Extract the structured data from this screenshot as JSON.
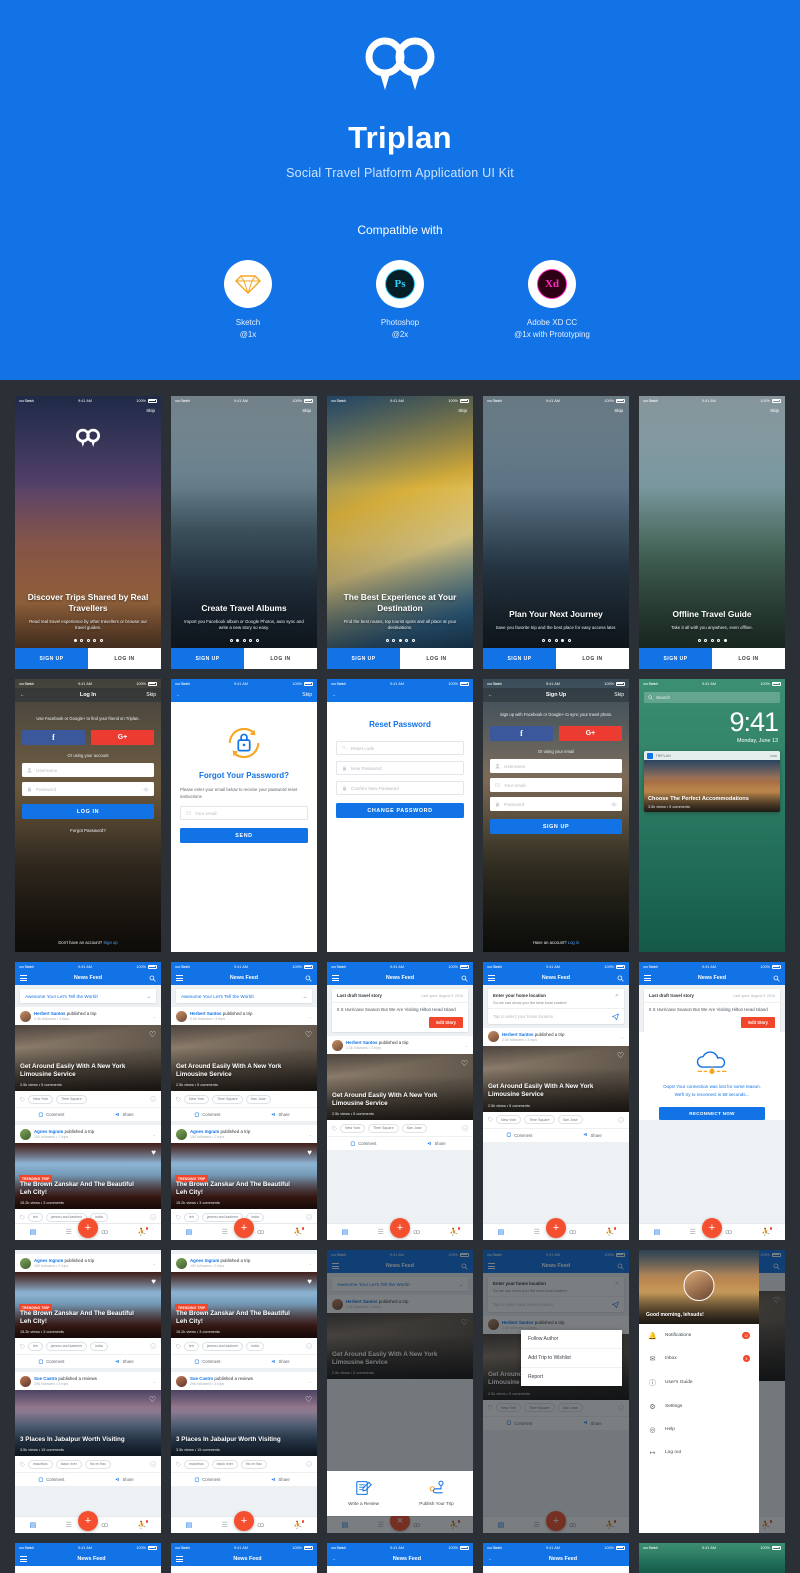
{
  "hero": {
    "logo_icon": "triplan-double-pin-logo",
    "title": "Triplan",
    "subtitle": "Social Travel Platform Application UI Kit",
    "compatible_label": "Compatible with",
    "compat": [
      {
        "icon": "sketch-icon",
        "name": "Sketch",
        "scale": "@1x"
      },
      {
        "icon": "photoshop-icon",
        "name": "Photoshop",
        "scale": "@2x"
      },
      {
        "icon": "adobe-xd-icon",
        "name": "Adobe XD CC",
        "scale": "@1x with Prototyping"
      }
    ]
  },
  "statusbar": {
    "carrier": "••••• Sketch",
    "wifi": "▼",
    "time": "9:41 AM",
    "battery": "100%"
  },
  "onboarding": {
    "skip": "Skip",
    "signup": "SIGN UP",
    "login": "LOG IN",
    "slides": [
      {
        "title": "Discover Trips Shared by Real Travellers",
        "desc": "Read real travel experience by other travellers or browse our travel guides.",
        "active_dot": 0,
        "dots": 5,
        "photo": "eiffel-tower",
        "show_logo": true
      },
      {
        "title": "Create Travel Albums",
        "desc": "Import you Facebook album or Google Photos, auto sync and write a new story so easy.",
        "active_dot": 1,
        "dots": 5,
        "photo": "woman-photographer-lake",
        "show_logo": false
      },
      {
        "title": "The Best Experience at Your Destination",
        "desc": "Find the best routes, top tourist spots and all place at your destinations.",
        "active_dot": 2,
        "dots": 5,
        "photo": "sailboat",
        "show_logo": false
      },
      {
        "title": "Plan Your Next Journey",
        "desc": "Save you favorite trip and the best place for easy access later.",
        "active_dot": 3,
        "dots": 5,
        "photo": "hiker-on-cliff",
        "show_logo": false
      },
      {
        "title": "Offline Travel Guide",
        "desc": "Take it all with you anywhere, even offline.",
        "active_dot": 4,
        "dots": 5,
        "photo": "limestone-cliffs",
        "show_logo": false
      }
    ]
  },
  "login": {
    "nav_title": "Log In",
    "skip": "Skip",
    "back_icon": "arrow-left-icon",
    "hint": "Use Facebook or Google+ to find your friend on Triplan.",
    "facebook_label": "f",
    "google_label": "G+",
    "or_text": "Or using your account",
    "username_placeholder": "Username",
    "password_placeholder": "Password",
    "submit": "LOG IN",
    "forgot": "Forgot Password?",
    "footer_text": "Don't have an account?",
    "footer_link": "Sign up"
  },
  "forgot": {
    "skip": "Skip",
    "title": "Forgot Your Password?",
    "desc": "Please enter your email below to receive your password reset instructions",
    "email_placeholder": "Your email",
    "submit": "SEND",
    "icon": "lock-refresh-icon"
  },
  "reset": {
    "title": "Reset Password",
    "code_placeholder": "Reset code",
    "new_placeholder": "New Password",
    "confirm_placeholder": "Confirm New Password",
    "submit": "CHANGE PASSWORD"
  },
  "signup": {
    "nav_title": "Sign Up",
    "skip": "Skip",
    "hint": "Sign up with Facebook or Google+ to sync your travel photo.",
    "facebook_label": "f",
    "google_label": "G+",
    "or_text": "Or using your email",
    "username_placeholder": "Username",
    "email_placeholder": "Your email",
    "password_placeholder": "Password",
    "submit": "SIGN UP",
    "footer_text": "Have an account?",
    "footer_link": "Log in"
  },
  "lockscreen": {
    "search_placeholder": "Search",
    "time": "9:41",
    "date": "Monday, June 13",
    "notification": {
      "app": "TRIPLAN",
      "time": "now",
      "title": "Choose The Perfect Accommodations",
      "meta": "3.5k views  •  5 comments"
    }
  },
  "feed": {
    "nav_title": "News Feed",
    "menu_icon": "hamburger-icon",
    "search_icon": "search-icon",
    "promo": "Awesome You! Let's Tell the World!",
    "draft": {
      "label": "Last draft travel story",
      "date": "Last open: August 9, 2016",
      "text": "It S Hurricane Season But We Are Visiting Hilton Head Island",
      "edit_button": "Edit Story"
    },
    "location_prompt": {
      "title": "Enter your home location",
      "subtitle": "So we can show you the best local content",
      "placeholder": "Tap to select your home location",
      "close_icon": "close-icon",
      "send_icon": "send-icon"
    },
    "actions": {
      "comment": "Comment",
      "share": "Share"
    },
    "posts": [
      {
        "author": "Herbert Santos",
        "action": "published a trip",
        "stats": "2.5k followers  •  3 trips",
        "title": "Get Around Easily With A New York Limousine Service",
        "meta": "2.5k views  •  5 comments",
        "tags": [
          "New York",
          "Time Square"
        ],
        "tags_extra": [
          "New York",
          "Time Square",
          "San Jose"
        ],
        "badge": "",
        "photo": "new-york-street",
        "avatar": "av-a"
      },
      {
        "author": "Agnes Ingram",
        "action": "published a trip",
        "stats": "150 followers  •  2 trips",
        "title": "The Brown Zanskar And The Beautiful Leh City!",
        "meta": "15.2k views  •  3 comments",
        "tags": [
          "leh",
          "jammu and kashmir",
          "india"
        ],
        "badge": "TRENDING TRIP",
        "photo": "leh-archway",
        "avatar": "av-b"
      },
      {
        "author": "Sue Castro",
        "action": "published a reviews",
        "stats": "296 followers  •  3 trips",
        "title": "3 Places In Jabalpur Worth Visiting",
        "meta": "3.5k views  •  15 comments",
        "tags": [
          "mauritius",
          "black river",
          "flic en flac"
        ],
        "badge": "",
        "photo": "jabalpur-mountains",
        "avatar": "av-c"
      }
    ],
    "tabbar": [
      {
        "icon": "feed-icon",
        "active": true,
        "dot": false
      },
      {
        "icon": "list-icon",
        "active": false,
        "dot": false
      },
      {
        "icon": "add-fab-icon",
        "active": false,
        "dot": false
      },
      {
        "icon": "binoculars-icon",
        "active": false,
        "dot": false
      },
      {
        "icon": "profile-icon",
        "active": false,
        "dot": true
      }
    ],
    "fab_add": "+",
    "fab_close": "×"
  },
  "offline": {
    "icon": "cloud-disconnected-icon",
    "line1": "Oops! Your connection was lost for some reason.",
    "line2": "We'll try to reconnect in 59 seconds...",
    "button": "RECONNECT NOW"
  },
  "action_sheet": [
    {
      "icon": "write-review-icon",
      "label": "Write a Review"
    },
    {
      "icon": "publish-trip-icon",
      "label": "Publish Your Trip"
    }
  ],
  "context_menu": [
    "Follow Author",
    "Add Trip to Wishlist",
    "Report"
  ],
  "drawer": {
    "greeting": "Good morning, lehsuds!",
    "avatar": "user-avatar",
    "items": [
      {
        "icon": "bell-icon",
        "label": "Notifications",
        "badge": "12"
      },
      {
        "icon": "envelope-icon",
        "label": "Inbox",
        "badge": "5"
      },
      {
        "icon": "info-icon",
        "label": "User's Guide",
        "badge": ""
      },
      {
        "icon": "gear-icon",
        "label": "Settings",
        "badge": ""
      },
      {
        "icon": "lifebuoy-icon",
        "label": "Help",
        "badge": ""
      },
      {
        "icon": "logout-icon",
        "label": "Log out",
        "badge": ""
      }
    ]
  }
}
